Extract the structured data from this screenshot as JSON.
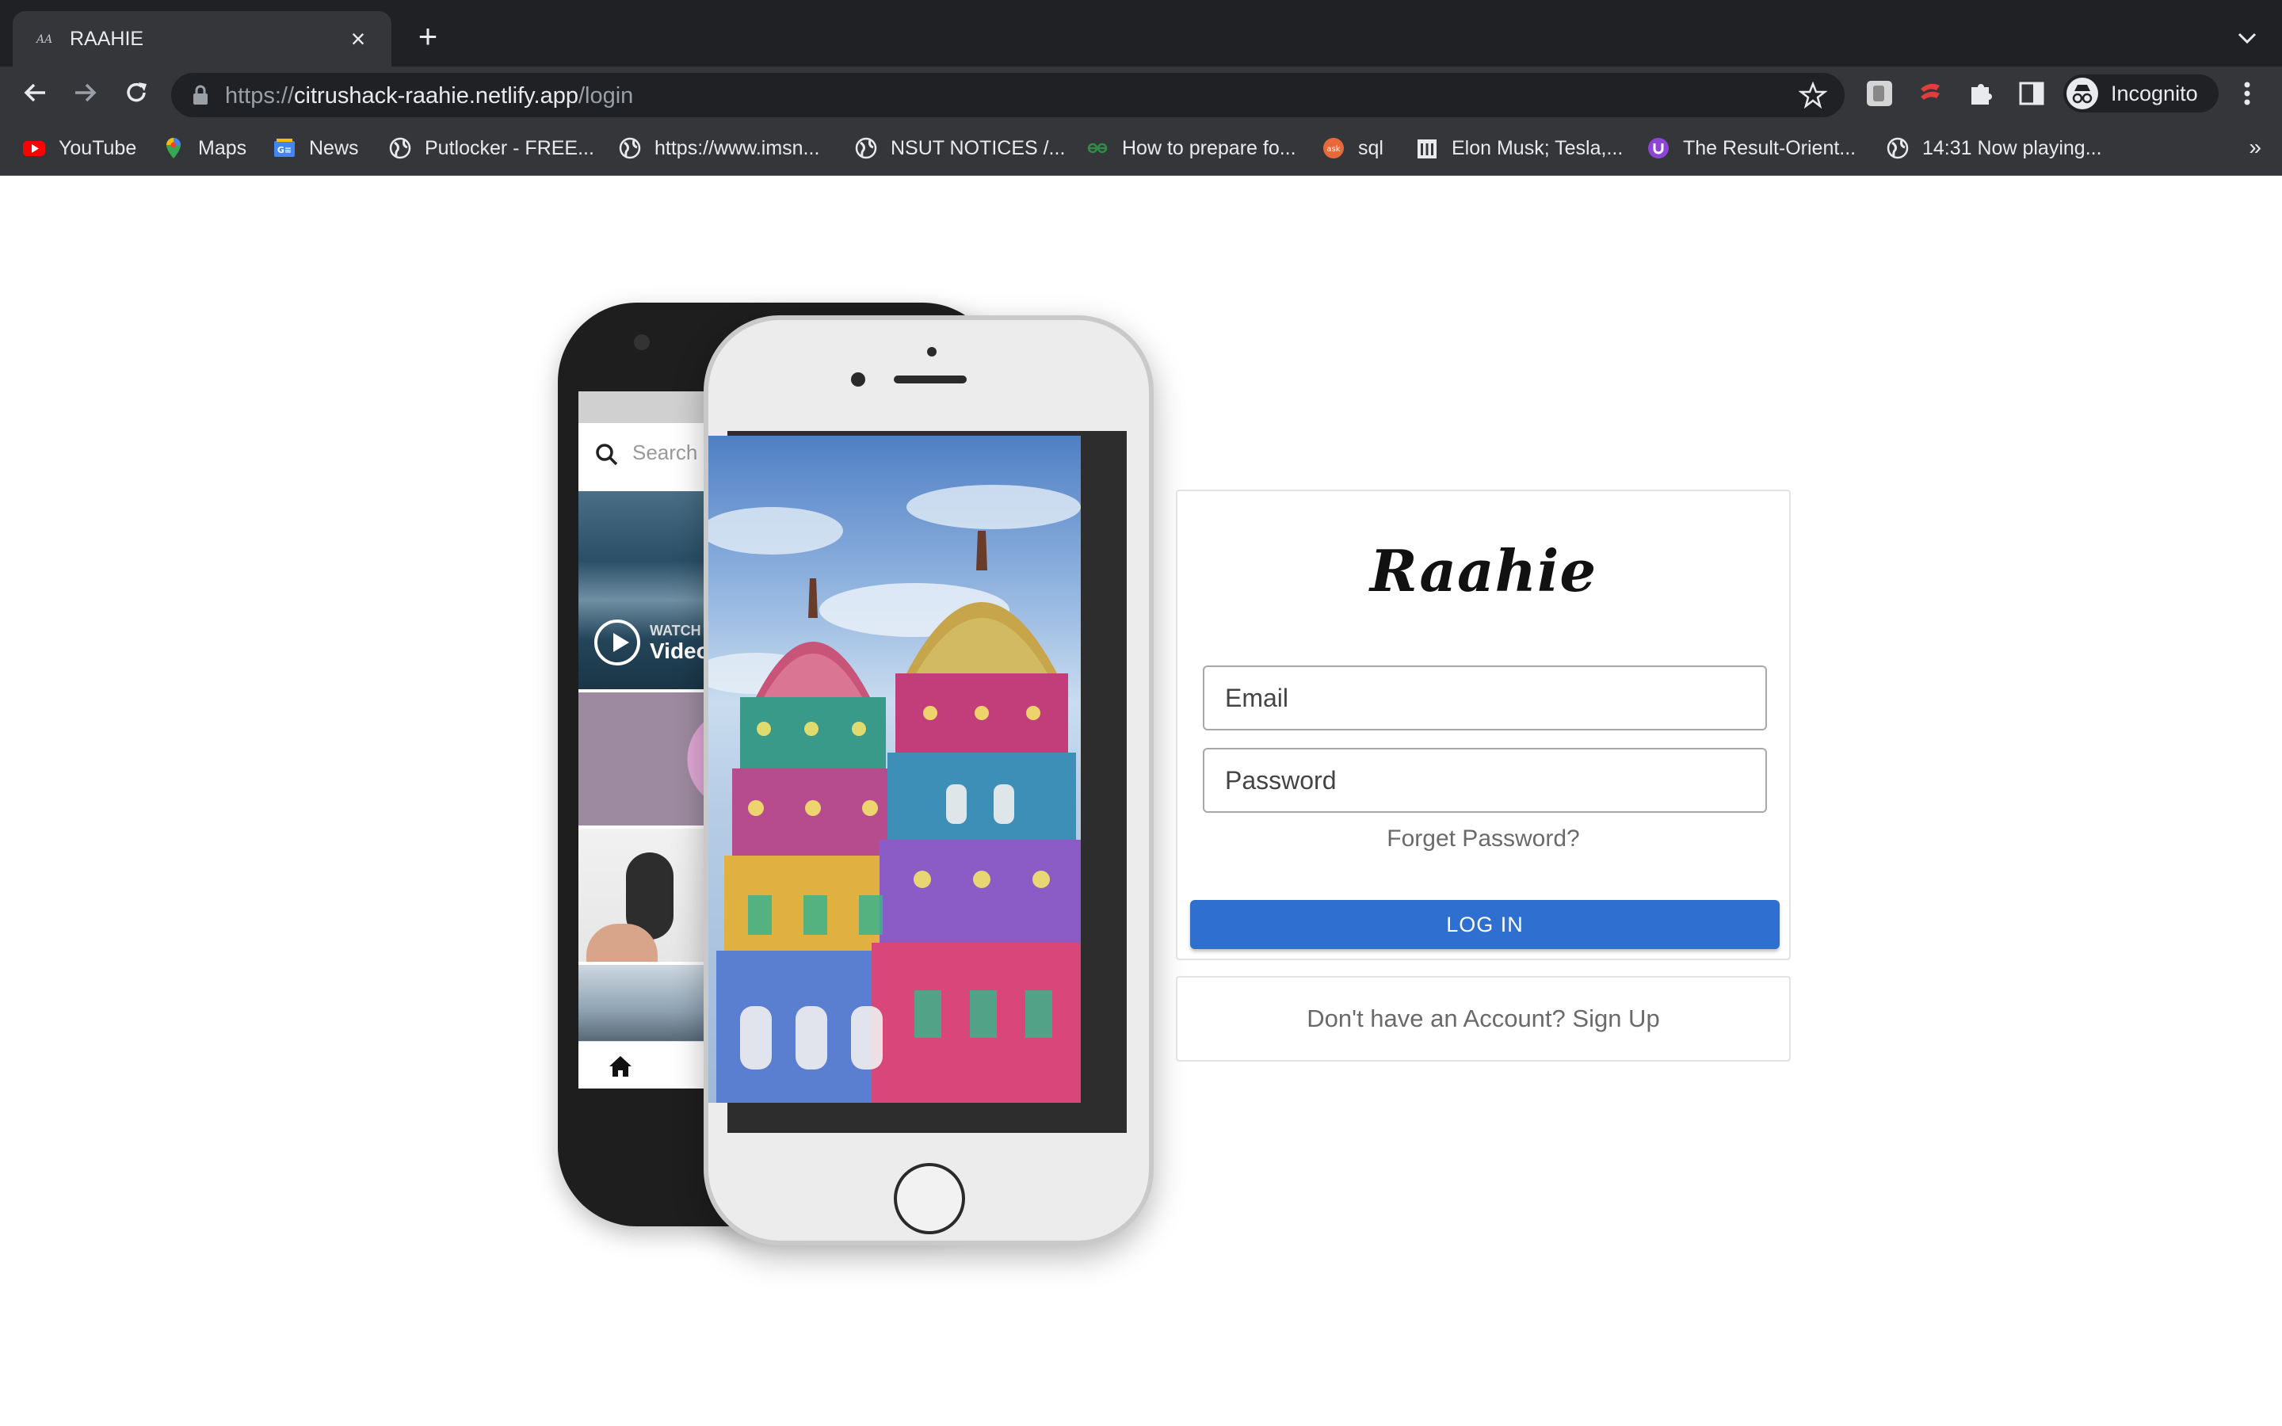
{
  "browser": {
    "tab_title": "RAAHIE",
    "tab_favicon": "AA",
    "url_scheme": "https://",
    "url_host": "citrushack-raahie.netlify.app",
    "url_path": "/login",
    "incognito_label": "Incognito",
    "bookmarks_more": "»",
    "bookmarks": [
      {
        "label": "YouTube",
        "icon": "youtube-icon"
      },
      {
        "label": "Maps",
        "icon": "maps-icon"
      },
      {
        "label": "News",
        "icon": "google-news-icon"
      },
      {
        "label": "Putlocker - FREE...",
        "icon": "globe-icon"
      },
      {
        "label": "https://www.imsn...",
        "icon": "globe-icon"
      },
      {
        "label": "NSUT NOTICES /...",
        "icon": "globe-icon"
      },
      {
        "label": "How to prepare fo...",
        "icon": "geeksforgeeks-icon"
      },
      {
        "label": "sql",
        "icon": "ask-icon"
      },
      {
        "label": "Elon Musk; Tesla,...",
        "icon": "building-icon"
      },
      {
        "label": "The Result-Orient...",
        "icon": "u-icon"
      },
      {
        "label": "14:31 Now playing...",
        "icon": "globe-icon"
      }
    ]
  },
  "phone_back": {
    "search_placeholder": "Search",
    "watch_label": "WATCH",
    "video_label": "Video"
  },
  "login": {
    "logo": "Raahie",
    "email_placeholder": "Email",
    "password_placeholder": "Password",
    "forgot_password": "Forget Password?",
    "login_button": "LOG IN",
    "button_color": "#2f6fd0"
  },
  "signup": {
    "prompt": "Don't have an Account? Sign Up"
  }
}
